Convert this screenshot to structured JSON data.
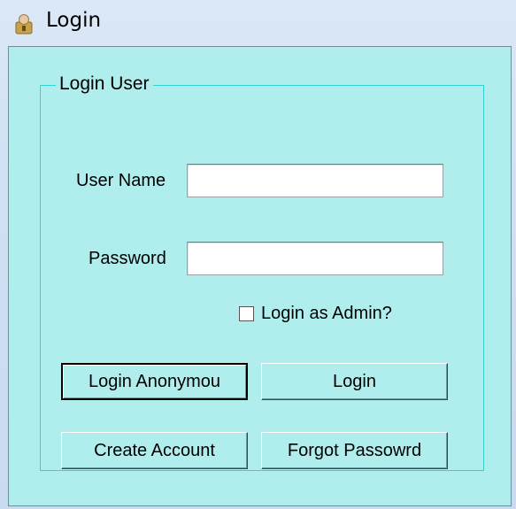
{
  "window": {
    "title": "Login"
  },
  "group": {
    "legend": "Login User"
  },
  "fields": {
    "username_label": "User Name",
    "username_value": "",
    "password_label": "Password",
    "password_value": ""
  },
  "admin_checkbox": {
    "label": "Login as Admin?",
    "checked": false
  },
  "buttons": {
    "login_anonymous": "Login Anonymou",
    "login": "Login",
    "create_account": "Create Account",
    "forgot_password": "Forgot Passowrd"
  },
  "icons": {
    "title_icon": "lock-user-icon"
  },
  "colors": {
    "window_bg": "#b0eeee",
    "group_border": "#3ad0d0"
  }
}
